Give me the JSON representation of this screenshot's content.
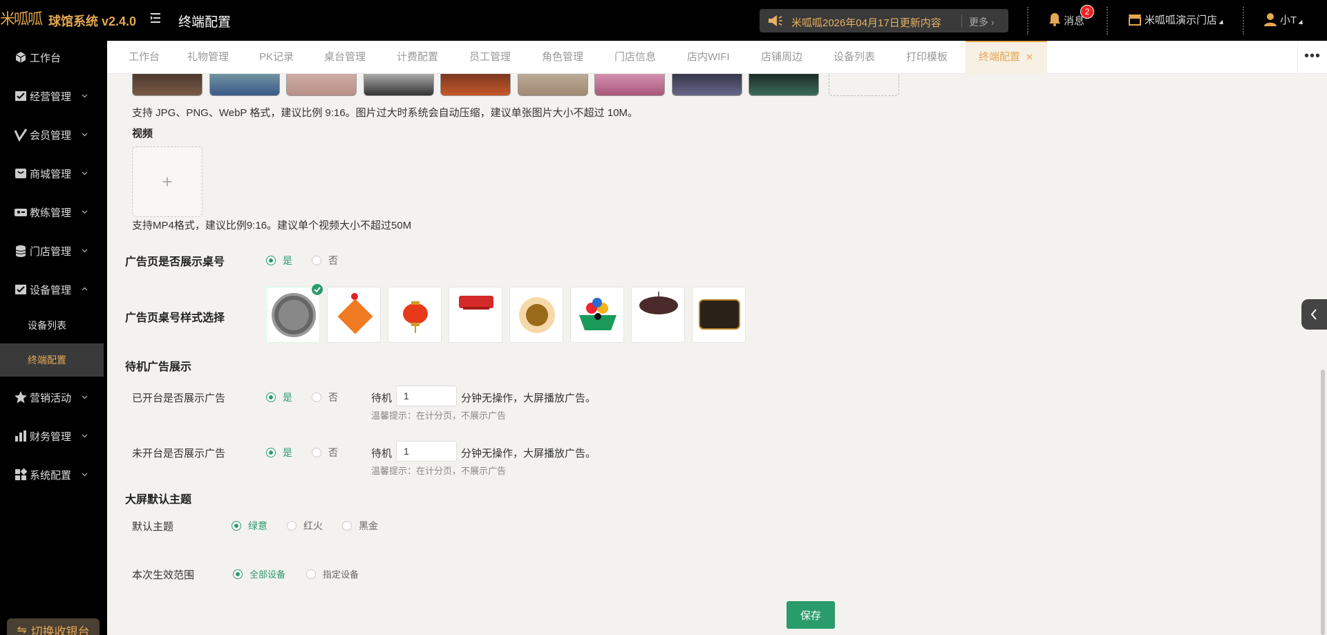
{
  "header": {
    "logo_text": "米呱呱",
    "app_name": "球馆系统 v2.4.0",
    "page_title": "终端配置",
    "notice_text": "米呱呱2026年04月17日更新内容",
    "notice_more": "更多",
    "messages_label": "消息",
    "messages_badge": "2",
    "store_name": "米呱呱演示门店",
    "user_name": "小T"
  },
  "sidebar": {
    "items": [
      {
        "label": "工作台",
        "icon": "cube-icon"
      },
      {
        "label": "经营管理",
        "icon": "store-icon"
      },
      {
        "label": "会员管理",
        "icon": "check-v-icon"
      },
      {
        "label": "商城管理",
        "icon": "shop-icon"
      },
      {
        "label": "教练管理",
        "icon": "coach-icon"
      },
      {
        "label": "门店管理",
        "icon": "coins-icon"
      },
      {
        "label": "设备管理",
        "icon": "device-icon"
      },
      {
        "label": "营销活动",
        "icon": "star-icon"
      },
      {
        "label": "财务管理",
        "icon": "chart-icon"
      },
      {
        "label": "系统配置",
        "icon": "grid-icon"
      }
    ],
    "sub_items": [
      {
        "label": "设备列表"
      },
      {
        "label": "终端配置",
        "active": true
      }
    ],
    "switch_button": "切换收银台"
  },
  "tabs": [
    "工作台",
    "礼物管理",
    "PK记录",
    "桌台管理",
    "计费配置",
    "员工管理",
    "角色管理",
    "门店信息",
    "店内WIFI",
    "店铺周边",
    "设备列表",
    "打印模板",
    "终端配置"
  ],
  "form": {
    "image_hint": "支持 JPG、PNG、WebP 格式，建议比例 9:16。图片过大时系统会自动压缩，建议单张图片大小不超过 10M。",
    "video_label": "视频",
    "video_hint": "支持MP4格式，建议比例9:16。建议单个视频大小不超过50M",
    "ad_show_table_label": "广告页是否展示桌号",
    "yes": "是",
    "no": "否",
    "ad_table_style_label": "广告页桌号样式选择",
    "standby_section": "待机广告展示",
    "opened_label": "已开台是否展示广告",
    "unopened_label": "未开台是否展示广告",
    "standby_prefix": "待机",
    "standby_suffix": "分钟无操作，大屏播放广告。",
    "standby_minutes_opened": "1",
    "standby_minutes_unopened": "1",
    "warm_tip": "温馨提示：在计分页，不展示广告",
    "theme_section": "大屏默认主题",
    "default_theme_label": "默认主题",
    "themes": [
      "绿意",
      "红火",
      "黑金"
    ],
    "scope_label": "本次生效范围",
    "scope_options": [
      "全部设备",
      "指定设备"
    ],
    "save_button": "保存"
  },
  "colors": {
    "accent_gold": "#e4a853",
    "primary_green": "#2a9b6a",
    "sidebar_bg": "#000000",
    "content_bg": "#f3f2ef"
  }
}
